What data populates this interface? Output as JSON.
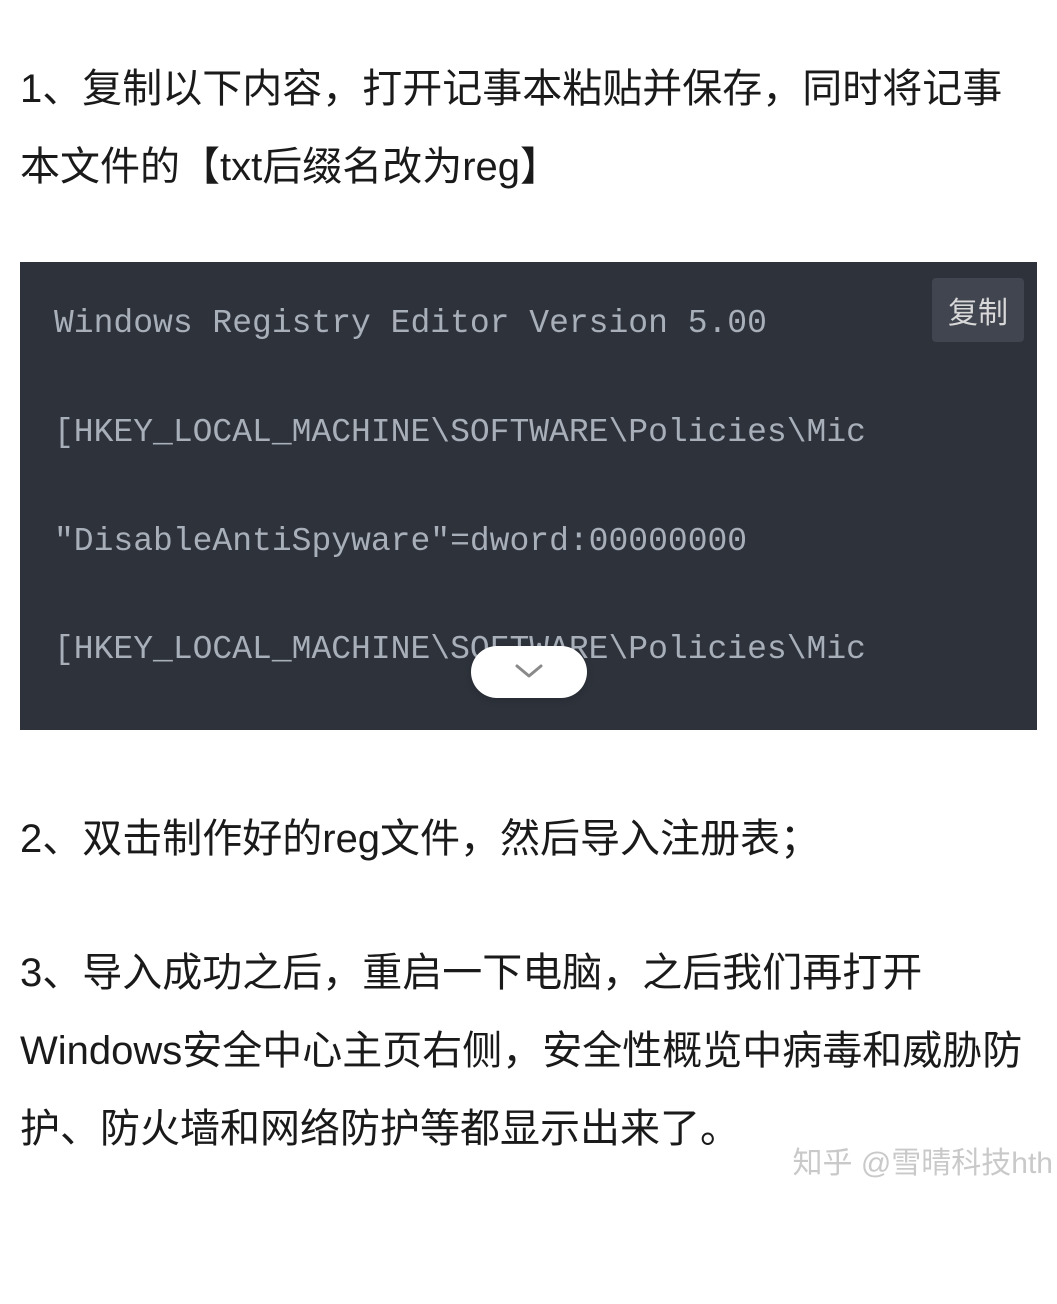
{
  "paragraphs": {
    "step1": "1、复制以下内容，打开记事本粘贴并保存，同时将记事本文件的【txt后缀名改为reg】",
    "step2": "2、双击制作好的reg文件，然后导入注册表；",
    "step3": "3、导入成功之后，重启一下电脑，之后我们再打开Windows安全中心主页右侧，安全性概览中病毒和威胁防护、防火墙和网络防护等都显示出来了。"
  },
  "code": {
    "line1": "Windows Registry Editor Version 5.00",
    "line2": "[HKEY_LOCAL_MACHINE\\SOFTWARE\\Policies\\Mic",
    "line3": "\"DisableAntiSpyware\"=dword:00000000",
    "line4": "[HKEY_LOCAL_MACHINE\\SOFTWARE\\Policies\\Mic"
  },
  "buttons": {
    "copy": "复制"
  },
  "watermark": "知乎 @雪晴科技hth"
}
